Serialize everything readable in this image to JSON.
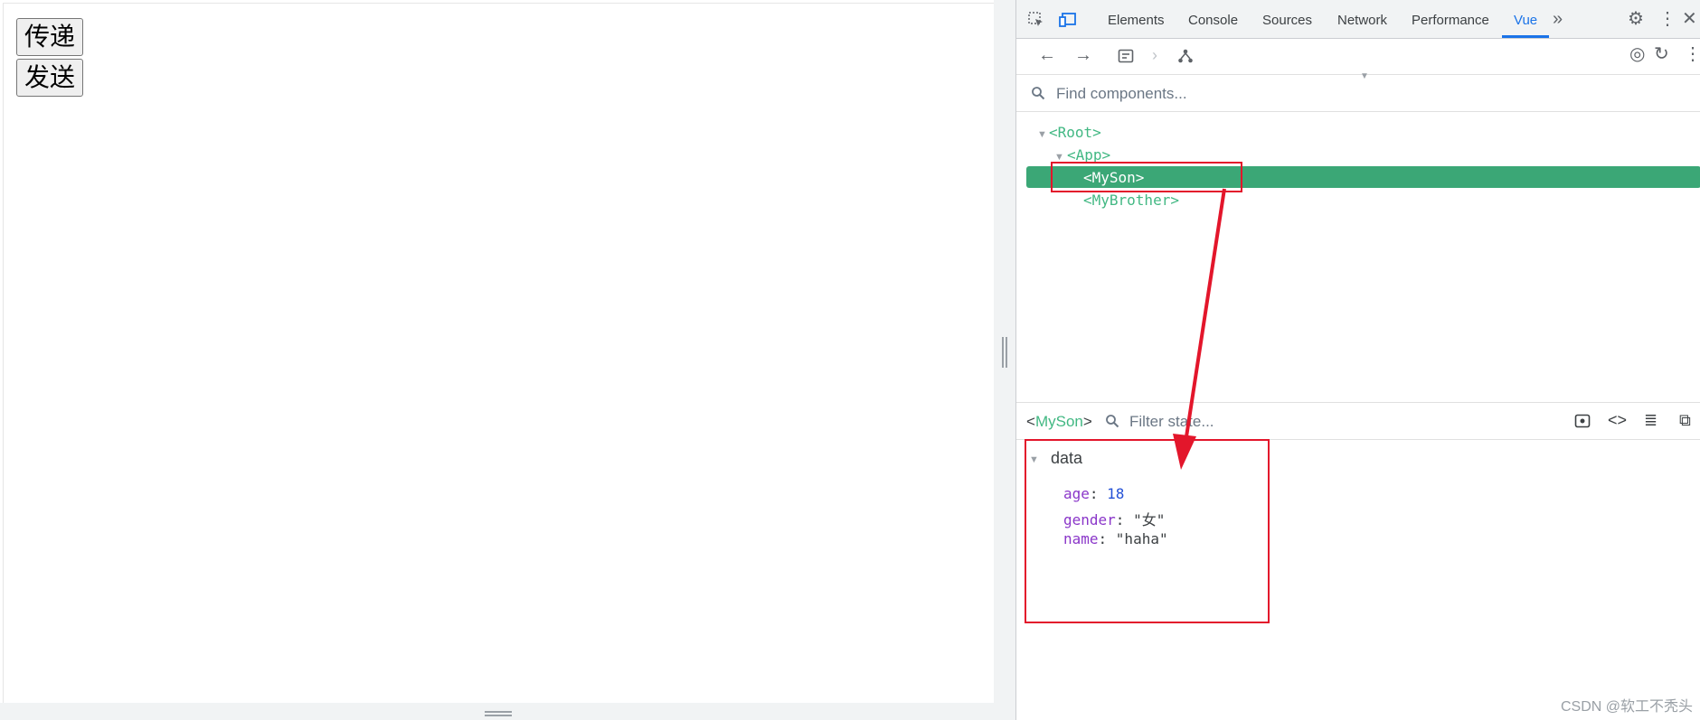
{
  "page": {
    "buttons": [
      {
        "label": "传递"
      },
      {
        "label": "发送"
      }
    ]
  },
  "devtools": {
    "tabs": [
      {
        "label": "Elements",
        "active": false
      },
      {
        "label": "Console",
        "active": false
      },
      {
        "label": "Sources",
        "active": false
      },
      {
        "label": "Network",
        "active": false
      },
      {
        "label": "Performance",
        "active": false
      },
      {
        "label": "Vue",
        "active": true
      }
    ],
    "more_tabs_icon": "double-chevron-right",
    "accent_color": "#1a73e8",
    "vue_green": "#42b883",
    "search": {
      "placeholder": "Find components..."
    },
    "tree": [
      {
        "label": "<Root>",
        "expanded": true
      },
      {
        "label": "<App>",
        "expanded": true
      },
      {
        "label": "<MySon>",
        "selected": true
      },
      {
        "label": "<MyBrother>"
      }
    ],
    "state_panel": {
      "component_open": "<",
      "component_name": "MySon",
      "component_close": ">",
      "filter_placeholder": "Filter state...",
      "section": "data",
      "props": [
        {
          "key": "age",
          "sep": ": ",
          "value": "18",
          "type": "number"
        },
        {
          "key": "gender",
          "sep": ": ",
          "value": "\"女\"",
          "type": "string"
        },
        {
          "key": "name",
          "sep": ": ",
          "value": "\"haha\"",
          "type": "string"
        }
      ]
    }
  },
  "annotation_color": "#e3162b",
  "watermark": "CSDN @软工不秃头"
}
